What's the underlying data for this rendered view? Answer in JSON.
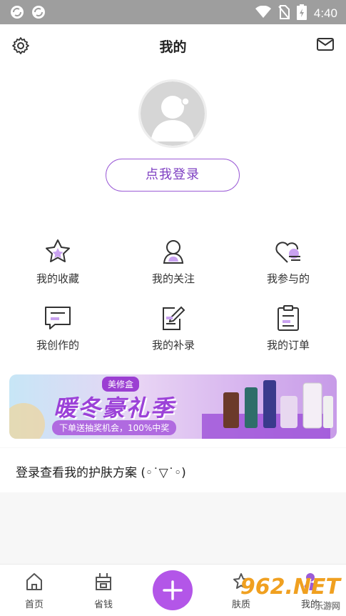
{
  "status_bar": {
    "time": "4:40"
  },
  "header": {
    "title": "我的"
  },
  "login": {
    "button_label": "点我登录"
  },
  "grid": [
    {
      "label": "我的收藏",
      "icon": "star-icon"
    },
    {
      "label": "我的关注",
      "icon": "user-follow-icon"
    },
    {
      "label": "我参与的",
      "icon": "heart-participate-icon"
    },
    {
      "label": "我创作的",
      "icon": "chat-create-icon"
    },
    {
      "label": "我的补录",
      "icon": "edit-note-icon"
    },
    {
      "label": "我的订单",
      "icon": "clipboard-order-icon"
    }
  ],
  "banner": {
    "tag": "美修盒",
    "headline": "暖冬豪礼季",
    "subtitle": "下单送抽奖机会，100%中奖"
  },
  "skin_plan": {
    "text": "登录查看我的护肤方案 (◦˙▽˙◦)"
  },
  "bottom_nav": [
    {
      "label": "首页",
      "icon": "home-icon"
    },
    {
      "label": "省钱",
      "icon": "save-money-icon"
    },
    {
      "label": "",
      "icon": "plus-icon"
    },
    {
      "label": "肤质",
      "icon": "skin-star-icon"
    },
    {
      "label": "我的",
      "icon": "profile-icon"
    }
  ],
  "watermark": {
    "brand": "962.NET",
    "site": "乐游网"
  },
  "colors": {
    "accent": "#9b5bd6",
    "fab": "#b356e8",
    "status_bar": "#9e9e9e"
  }
}
